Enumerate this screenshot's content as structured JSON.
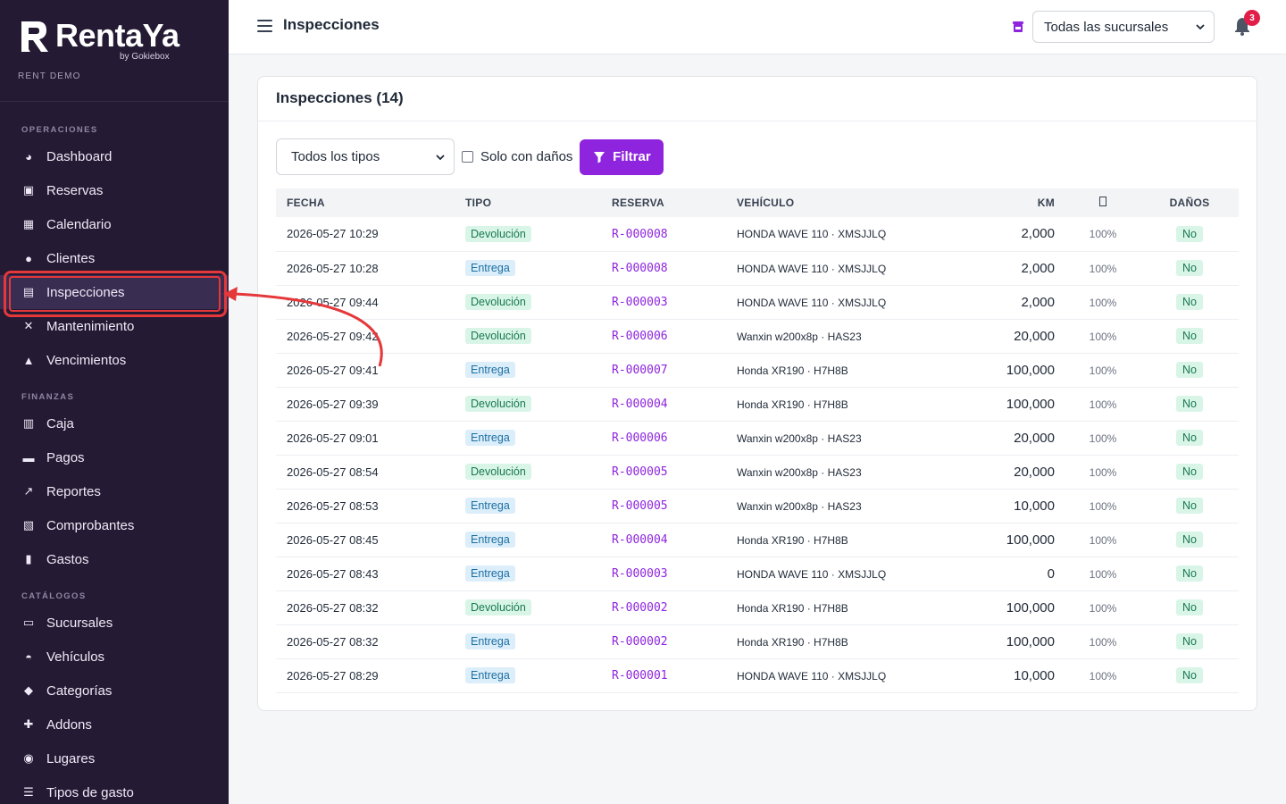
{
  "brand": {
    "name": "RentaYa",
    "by": "by Gokiebox",
    "tenant": "RENT DEMO"
  },
  "sidebar": {
    "sections": [
      {
        "title": "OPERACIONES",
        "items": [
          {
            "label": "Dashboard",
            "icon": "palette-icon"
          },
          {
            "label": "Reservas",
            "icon": "calendar-check-icon"
          },
          {
            "label": "Calendario",
            "icon": "calendar-icon"
          },
          {
            "label": "Clientes",
            "icon": "users-icon"
          },
          {
            "label": "Inspecciones",
            "icon": "clipboard-check-icon",
            "active": true
          },
          {
            "label": "Mantenimiento",
            "icon": "tools-icon"
          },
          {
            "label": "Vencimientos",
            "icon": "bell-icon"
          }
        ]
      },
      {
        "title": "FINANZAS",
        "items": [
          {
            "label": "Caja",
            "icon": "cash-register-icon"
          },
          {
            "label": "Pagos",
            "icon": "credit-card-icon"
          },
          {
            "label": "Reportes",
            "icon": "chart-line-icon"
          },
          {
            "label": "Comprobantes",
            "icon": "file-invoice-icon"
          },
          {
            "label": "Gastos",
            "icon": "receipt-icon"
          }
        ]
      },
      {
        "title": "CATÁLOGOS",
        "items": [
          {
            "label": "Sucursales",
            "icon": "store-icon"
          },
          {
            "label": "Vehículos",
            "icon": "car-icon"
          },
          {
            "label": "Categorías",
            "icon": "tags-icon"
          },
          {
            "label": "Addons",
            "icon": "puzzle-icon"
          },
          {
            "label": "Lugares",
            "icon": "map-location-icon"
          },
          {
            "label": "Tipos de gasto",
            "icon": "list-icon"
          }
        ]
      }
    ]
  },
  "topbar": {
    "title": "Inspecciones",
    "branch_select": "Todas las sucursales",
    "notifications_count": "3"
  },
  "card": {
    "title": "Inspecciones (14)",
    "type_filter": "Todos los tipos",
    "damage_only_label": "Solo con daños",
    "filter_button": "Filtrar"
  },
  "table": {
    "columns": [
      "FECHA",
      "TIPO",
      "RESERVA",
      "VEHÍCULO",
      "KM",
      "",
      "DAÑOS"
    ],
    "rows": [
      {
        "fecha": "2026-05-27 10:29",
        "tipo": "Devolución",
        "reserva": "R-000008",
        "vehiculo": "HONDA WAVE 110 · XMSJJLQ",
        "km": "2,000",
        "pct": "100%",
        "danos": "No"
      },
      {
        "fecha": "2026-05-27 10:28",
        "tipo": "Entrega",
        "reserva": "R-000008",
        "vehiculo": "HONDA WAVE 110 · XMSJJLQ",
        "km": "2,000",
        "pct": "100%",
        "danos": "No"
      },
      {
        "fecha": "2026-05-27 09:44",
        "tipo": "Devolución",
        "reserva": "R-000003",
        "vehiculo": "HONDA WAVE 110 · XMSJJLQ",
        "km": "2,000",
        "pct": "100%",
        "danos": "No"
      },
      {
        "fecha": "2026-05-27 09:42",
        "tipo": "Devolución",
        "reserva": "R-000006",
        "vehiculo": "Wanxin w200x8p · HAS23",
        "km": "20,000",
        "pct": "100%",
        "danos": "No"
      },
      {
        "fecha": "2026-05-27 09:41",
        "tipo": "Entrega",
        "reserva": "R-000007",
        "vehiculo": "Honda XR190 · H7H8B",
        "km": "100,000",
        "pct": "100%",
        "danos": "No"
      },
      {
        "fecha": "2026-05-27 09:39",
        "tipo": "Devolución",
        "reserva": "R-000004",
        "vehiculo": "Honda XR190 · H7H8B",
        "km": "100,000",
        "pct": "100%",
        "danos": "No"
      },
      {
        "fecha": "2026-05-27 09:01",
        "tipo": "Entrega",
        "reserva": "R-000006",
        "vehiculo": "Wanxin w200x8p · HAS23",
        "km": "20,000",
        "pct": "100%",
        "danos": "No"
      },
      {
        "fecha": "2026-05-27 08:54",
        "tipo": "Devolución",
        "reserva": "R-000005",
        "vehiculo": "Wanxin w200x8p · HAS23",
        "km": "20,000",
        "pct": "100%",
        "danos": "No"
      },
      {
        "fecha": "2026-05-27 08:53",
        "tipo": "Entrega",
        "reserva": "R-000005",
        "vehiculo": "Wanxin w200x8p · HAS23",
        "km": "10,000",
        "pct": "100%",
        "danos": "No"
      },
      {
        "fecha": "2026-05-27 08:45",
        "tipo": "Entrega",
        "reserva": "R-000004",
        "vehiculo": "Honda XR190 · H7H8B",
        "km": "100,000",
        "pct": "100%",
        "danos": "No"
      },
      {
        "fecha": "2026-05-27 08:43",
        "tipo": "Entrega",
        "reserva": "R-000003",
        "vehiculo": "HONDA WAVE 110 · XMSJJLQ",
        "km": "0",
        "pct": "100%",
        "danos": "No"
      },
      {
        "fecha": "2026-05-27 08:32",
        "tipo": "Devolución",
        "reserva": "R-000002",
        "vehiculo": "Honda XR190 · H7H8B",
        "km": "100,000",
        "pct": "100%",
        "danos": "No"
      },
      {
        "fecha": "2026-05-27 08:32",
        "tipo": "Entrega",
        "reserva": "R-000002",
        "vehiculo": "Honda XR190 · H7H8B",
        "km": "100,000",
        "pct": "100%",
        "danos": "No"
      },
      {
        "fecha": "2026-05-27 08:29",
        "tipo": "Entrega",
        "reserva": "R-000001",
        "vehiculo": "HONDA WAVE 110 · XMSJJLQ",
        "km": "10,000",
        "pct": "100%",
        "danos": "No"
      }
    ]
  },
  "colors": {
    "sidebar_bg": "#241a33",
    "accent": "#8e24dd",
    "annotation": "#e5383b"
  }
}
